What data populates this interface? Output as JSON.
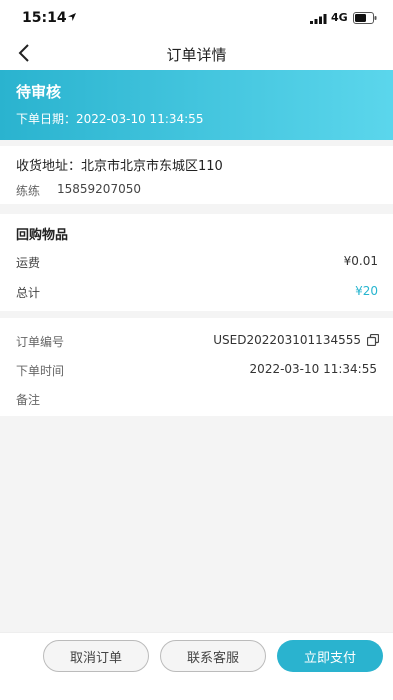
{
  "status_bar": {
    "time": "15:14",
    "network": "4G"
  },
  "nav": {
    "title": "订单详情"
  },
  "banner": {
    "status": "待审核",
    "date": "下单日期：2022-03-10 11:34:55"
  },
  "address": {
    "line": "收货地址：北京市北京市东城区110",
    "name": "练练",
    "phone": "15859207050"
  },
  "goods": {
    "title": "回购物品",
    "shipping_label": "运费",
    "shipping_value": "¥0.01",
    "total_label": "总计",
    "total_value": "¥20"
  },
  "order_info": {
    "no_label": "订单编号",
    "no_value": "USED202203101134555",
    "time_label": "下单时间",
    "time_value": "2022-03-10 11:34:55",
    "note_label": "备注"
  },
  "footer": {
    "cancel": "取消订单",
    "service": "联系客服",
    "pay": "立即支付"
  },
  "colors": {
    "accent": "#2ab3cf",
    "accent_light": "#5bd6ec"
  }
}
